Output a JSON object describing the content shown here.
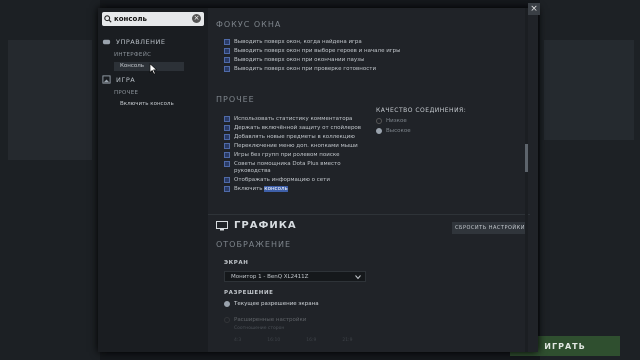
{
  "search": {
    "value": "консоль"
  },
  "sidebar": {
    "management": "УПРАВЛЕНИЕ",
    "interface": "ИНТЕРФЕЙС",
    "console_leaf": "Консоль",
    "game": "ИГРА",
    "other": "ПРОЧЕЕ",
    "enable_console_leaf": "Включить консоль"
  },
  "focus": {
    "title": "ФОКУС ОКНА",
    "items": [
      "Выводить поверх окон, когда найдена игра",
      "Выводить поверх окон при выборе героев и начале игры",
      "Выводить поверх окон при окончании паузы",
      "Выводить поверх окон при проверке готовности"
    ]
  },
  "other": {
    "title": "ПРОЧЕЕ",
    "items": [
      "Использовать статистику комментатора",
      "Держать включённой защиту от спойлеров",
      "Добавлять новые предметы в коллекцию",
      "Переключение меню доп. кнопками мыши",
      "Игры без групп при ролевом поиске",
      "Советы помощника Dota Plus вместо",
      "руководства",
      "Отображать информацию о сети"
    ],
    "enable_prefix": "Включить ",
    "enable_highlight": "консоль"
  },
  "quality": {
    "title": "КАЧЕСТВО СОЕДИНЕНИЯ:",
    "low": "Низкое",
    "high": "Высокое"
  },
  "graphics": {
    "title": "ГРАФИКА",
    "reset": "СБРОСИТЬ НАСТРОЙКИ",
    "display": "ОТОБРАЖЕНИЕ",
    "screen_label": "ЭКРАН",
    "monitor": "Монитор 1 - BenQ XL2411Z",
    "resolution_label": "РАЗРЕШЕНИЕ",
    "current_res": "Текущее разрешение экрана",
    "advanced": "Расширенные настройки",
    "advanced_sub": "Соотношение сторон",
    "aspects": [
      "4:3",
      "16:10",
      "16:9",
      "21:9"
    ]
  },
  "play": "ИГРАТЬ",
  "close": "×"
}
